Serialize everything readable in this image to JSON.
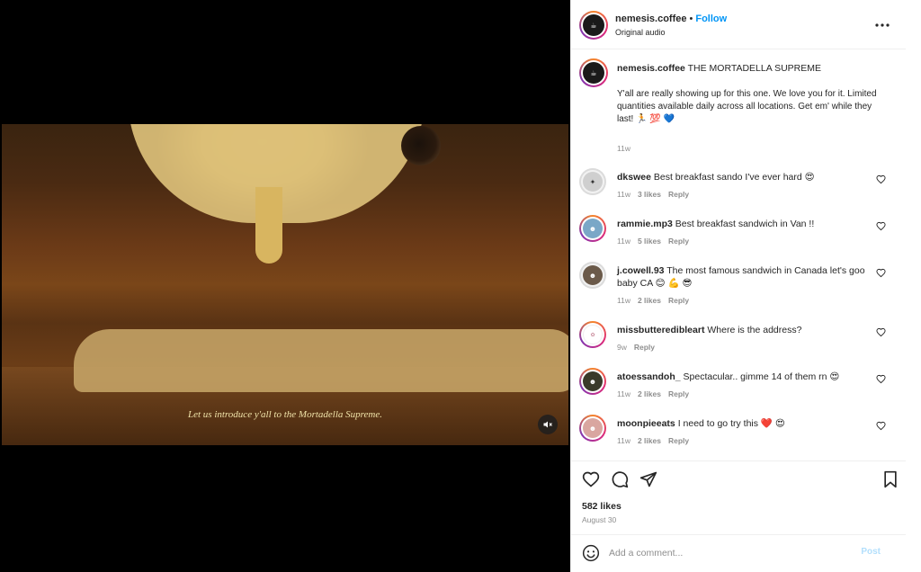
{
  "video": {
    "caption": "Let us introduce y'all to the Mortadella Supreme."
  },
  "header": {
    "username": "nemesis.coffee",
    "separator": "•",
    "follow_label": "Follow",
    "audio": "Original audio",
    "more_icon": "more-horizontal-icon"
  },
  "post_caption": {
    "username": "nemesis.coffee",
    "title": "THE MORTADELLA SUPREME",
    "body": "Y'all are really showing up for this one. We love you for it. Limited quantities available daily across all locations. Get em' while they last! 🏃 💯 💙",
    "time": "11w"
  },
  "comments": [
    {
      "username": "dkswee",
      "text": "Best breakfast sando I've ever hard 😍",
      "time": "11w",
      "likes": "3 likes",
      "reply": "Reply"
    },
    {
      "username": "rammie.mp3",
      "text": "Best breakfast sandwich in Van !!",
      "time": "11w",
      "likes": "5 likes",
      "reply": "Reply"
    },
    {
      "username": "j.cowell.93",
      "text": "The most famous sandwich in Canada let's goo baby CA 😊 💪 😎",
      "time": "11w",
      "likes": "2 likes",
      "reply": "Reply"
    },
    {
      "username": "missbutteredibleart",
      "text": "Where is the address?",
      "time": "9w",
      "likes": "",
      "reply": "Reply"
    },
    {
      "username": "atoessandoh_",
      "text": "Spectacular.. gimme 14 of them rn 😍",
      "time": "11w",
      "likes": "2 likes",
      "reply": "Reply"
    },
    {
      "username": "moonpieeats",
      "text": "I need to go try this ❤️ 😍",
      "time": "11w",
      "likes": "2 likes",
      "reply": "Reply"
    }
  ],
  "stats": {
    "likes": "582 likes",
    "date": "August 30"
  },
  "composer": {
    "placeholder": "Add a comment...",
    "post_label": "Post"
  },
  "colors": {
    "accent": "#0095f6",
    "muted": "#8e8e8e",
    "post_disabled": "#b2dffc"
  }
}
